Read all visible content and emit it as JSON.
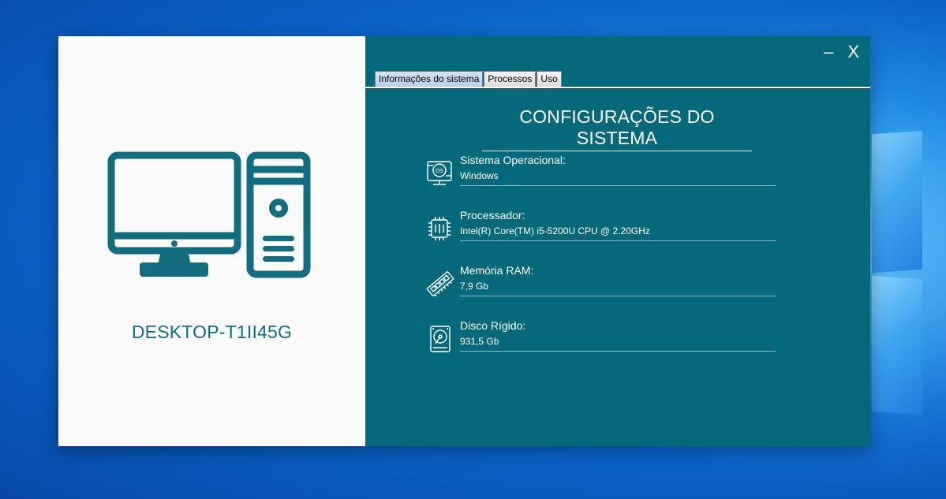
{
  "window": {
    "minimize_label": "–",
    "close_label": "X"
  },
  "left_panel": {
    "illustration_icon": "desktop-computer-icon",
    "hostname": "DESKTOP-T1II45G"
  },
  "tabs": [
    {
      "label": "Informações do sistema",
      "active": true
    },
    {
      "label": "Processos",
      "active": false
    },
    {
      "label": "Uso",
      "active": false
    }
  ],
  "main": {
    "title": "CONFIGURAÇÕES DO SISTEMA",
    "items": [
      {
        "icon": "os-icon",
        "label": "Sistema Operacional:",
        "value": "Windows"
      },
      {
        "icon": "cpu-icon",
        "label": "Processador:",
        "value": "Intel(R) Core(TM) i5-5200U CPU @ 2.20GHz"
      },
      {
        "icon": "ram-icon",
        "label": "Memória RAM:",
        "value": "7,9 Gb"
      },
      {
        "icon": "hard-disk-icon",
        "label": "Disco Rígido:",
        "value": "931,5 Gb"
      }
    ]
  },
  "colors": {
    "accent": "#05697b",
    "left_background": "#fafafa",
    "hostname_text": "#126d80"
  }
}
